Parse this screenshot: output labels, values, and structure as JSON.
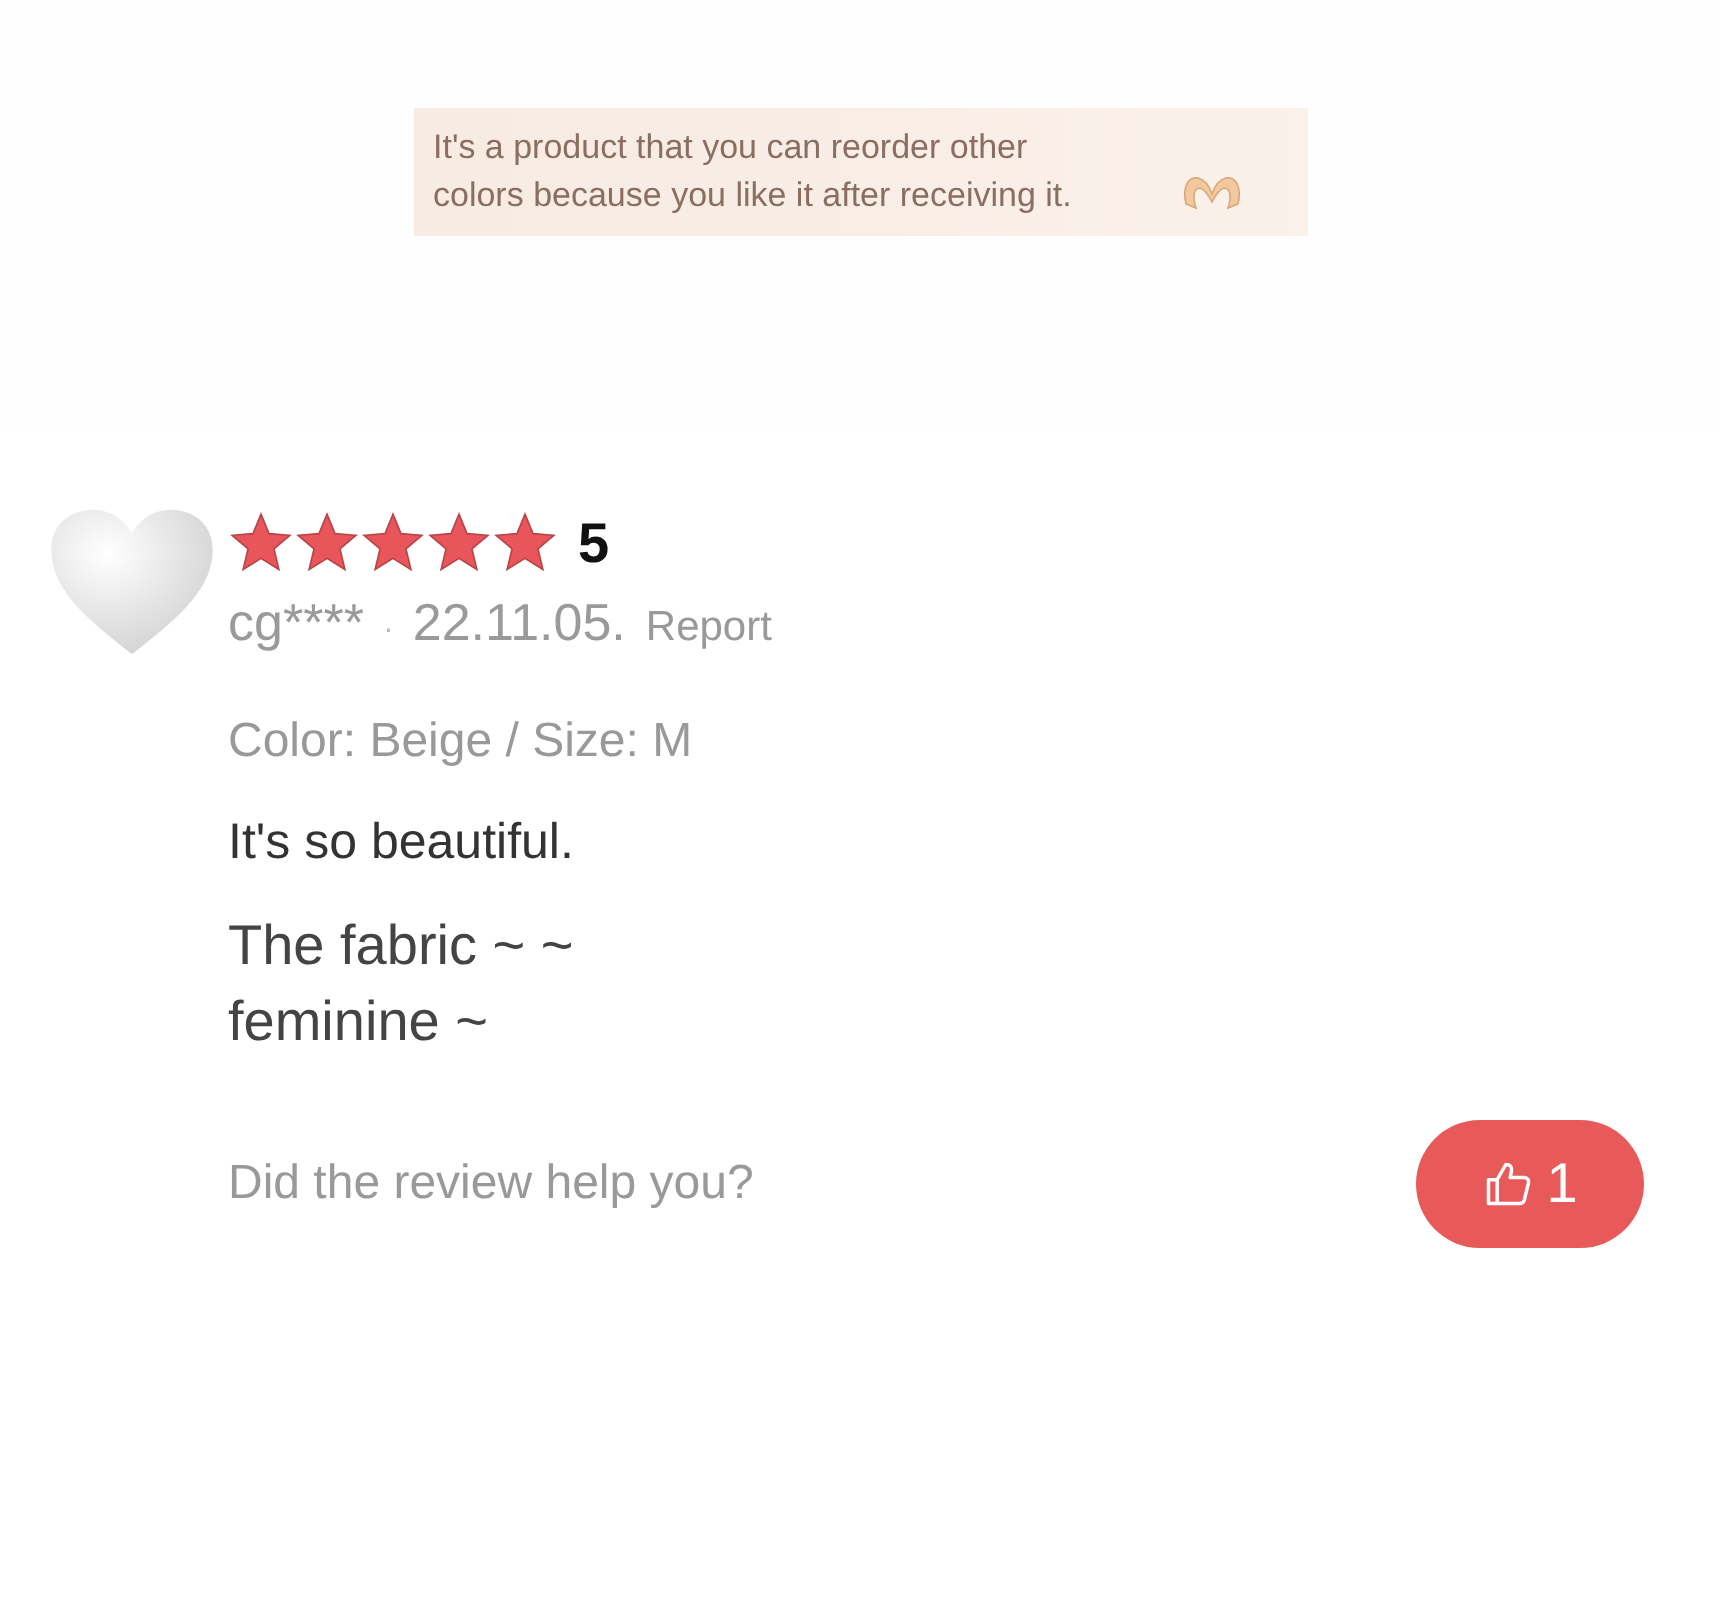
{
  "banner": {
    "text": "It's a product that you can reorder other colors because you like it after receiving it."
  },
  "review": {
    "stars": 5,
    "rating": "5",
    "user": "cg****",
    "separator": "·",
    "date": "22.11.05.",
    "report": "Report",
    "option": "Color: Beige / Size: M",
    "body": "It's so beautiful.",
    "body_large": [
      "The fabric ~ ~",
      "feminine ~"
    ],
    "helpful_prompt": "Did the review help you?",
    "like_count": "1"
  }
}
